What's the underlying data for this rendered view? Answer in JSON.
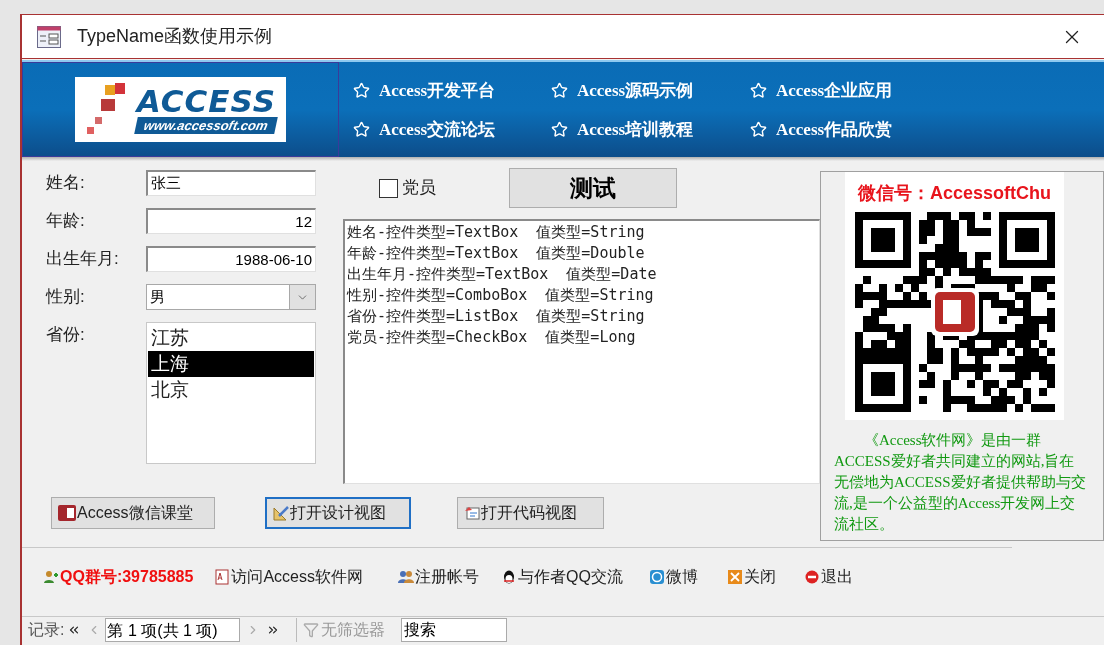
{
  "window": {
    "title": "TypeName函数使用示例"
  },
  "banner": {
    "logo": {
      "title": "ACCESS",
      "url": "www.accessoft.com"
    },
    "links": [
      "Access开发平台",
      "Access源码示例",
      "Access企业应用",
      "Access交流论坛",
      "Access培训教程",
      "Access作品欣赏"
    ]
  },
  "form": {
    "fields": [
      {
        "kind": "text",
        "label": "姓名:",
        "value": "张三",
        "right_aligned": false
      },
      {
        "kind": "text",
        "label": "年龄:",
        "value": "12",
        "right_aligned": true
      },
      {
        "kind": "text",
        "label": "出生年月:",
        "value": "1988-06-10",
        "right_aligned": true
      },
      {
        "kind": "combo",
        "label": "性别:",
        "value": "男"
      },
      {
        "kind": "list",
        "label": "省份:",
        "options": [
          {
            "label": "江苏",
            "selected": false
          },
          {
            "label": "上海",
            "selected": true
          },
          {
            "label": "北京",
            "selected": false
          }
        ]
      }
    ],
    "checkbox": {
      "label": "党员",
      "checked": false
    },
    "test_button": "测试",
    "output": [
      "姓名-控件类型=TextBox  值类型=String",
      "年龄-控件类型=TextBox  值类型=Double",
      "出生年月-控件类型=TextBox  值类型=Date",
      "性别-控件类型=ComboBox  值类型=String",
      "省份-控件类型=ListBox  值类型=String",
      "党员-控件类型=CheckBox  值类型=Long"
    ],
    "buttons": [
      {
        "kind": "wechat",
        "label": "Access微信课堂",
        "focused": false
      },
      {
        "kind": "design",
        "label": "打开设计视图",
        "focused": true
      },
      {
        "kind": "code",
        "label": "打开代码视图",
        "focused": false
      }
    ]
  },
  "promo": {
    "heading": "微信号：AccessoftChu",
    "description": "《Access软件网》是由一群ACCESS爱好者共同建立的网站,旨在无偿地为ACCESS爱好者提供帮助与交流,是一个公益型的Access开发网上交流社区。"
  },
  "links": [
    {
      "kind": "qq_group",
      "label": "QQ群号:39785885"
    },
    {
      "kind": "site",
      "label": "访问Access软件网"
    },
    {
      "kind": "register",
      "label": "注册帐号"
    },
    {
      "kind": "qq",
      "label": "与作者QQ交流"
    },
    {
      "kind": "weibo",
      "label": "微博"
    },
    {
      "kind": "close",
      "label": "关闭"
    },
    {
      "kind": "exit",
      "label": "退出"
    }
  ],
  "record_nav": {
    "label": "记录:",
    "position": "第 1 项(共 1 项)",
    "filter": "无筛选器",
    "search": "搜索"
  }
}
